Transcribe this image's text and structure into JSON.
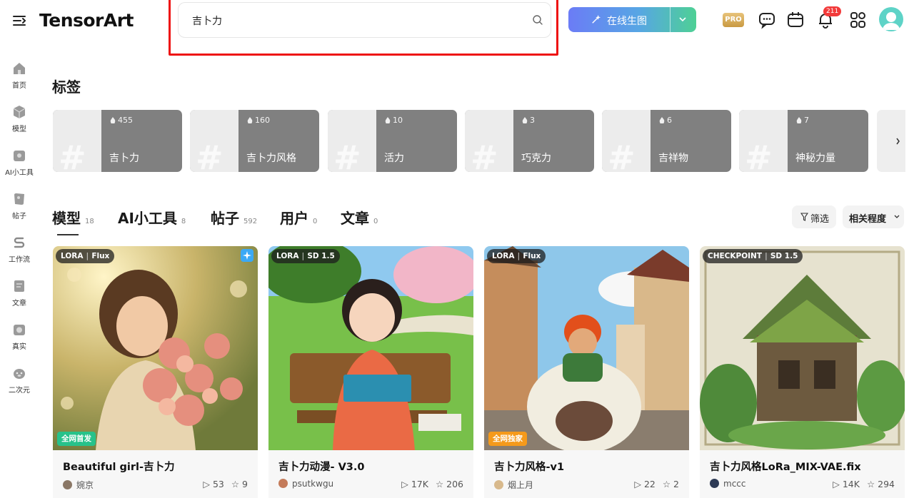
{
  "header": {
    "logo_text": "TensorArt",
    "search_value": "吉卜力",
    "generate_label": "在线生图",
    "pro_label": "PRO",
    "notification_count": "211"
  },
  "sidebar": {
    "items": [
      {
        "label": "首页",
        "icon": "home-icon"
      },
      {
        "label": "模型",
        "icon": "cube-icon"
      },
      {
        "label": "AI小工具",
        "icon": "tool-icon"
      },
      {
        "label": "帖子",
        "icon": "post-icon"
      },
      {
        "label": "工作流",
        "icon": "workflow-icon"
      },
      {
        "label": "文章",
        "icon": "article-icon"
      },
      {
        "label": "真实",
        "icon": "camera-icon"
      },
      {
        "label": "二次元",
        "icon": "anime-icon"
      }
    ]
  },
  "tags_section": {
    "title": "标签",
    "tags": [
      {
        "name": "吉卜力",
        "count": "455"
      },
      {
        "name": "吉卜力风格",
        "count": "160"
      },
      {
        "name": "活力",
        "count": "10"
      },
      {
        "name": "巧克力",
        "count": "3"
      },
      {
        "name": "吉祥物",
        "count": "6"
      },
      {
        "name": "神秘力量",
        "count": "7"
      }
    ]
  },
  "tabs": [
    {
      "label": "模型",
      "count": "18"
    },
    {
      "label": "AI小工具",
      "count": "8"
    },
    {
      "label": "帖子",
      "count": "592"
    },
    {
      "label": "用户",
      "count": "0"
    },
    {
      "label": "文章",
      "count": "0"
    }
  ],
  "filters": {
    "filter_label": "筛选",
    "sort_label": "相关程度"
  },
  "cards": [
    {
      "type": "LORA",
      "base": "Flux",
      "promo": "全网首发",
      "promo_color": "#27c28a",
      "title": "Beautiful girl-吉卜力",
      "author": "婉京",
      "runs": "53",
      "stars": "9"
    },
    {
      "type": "LORA",
      "base": "SD 1.5",
      "promo": "",
      "promo_color": "",
      "title": "吉卜力动漫- V3.0",
      "author": "psutkwgu",
      "runs": "17K",
      "stars": "206"
    },
    {
      "type": "LORA",
      "base": "Flux",
      "promo": "全网独家",
      "promo_color": "#f59a1b",
      "title": "吉卜力风格-v1",
      "author": "烟上月",
      "runs": "22",
      "stars": "2"
    },
    {
      "type": "CHECKPOINT",
      "base": "SD 1.5",
      "promo": "",
      "promo_color": "",
      "title": "吉卜力风格LoRa_MIX-VAE.fix",
      "author": "mccc",
      "runs": "14K",
      "stars": "294"
    }
  ]
}
